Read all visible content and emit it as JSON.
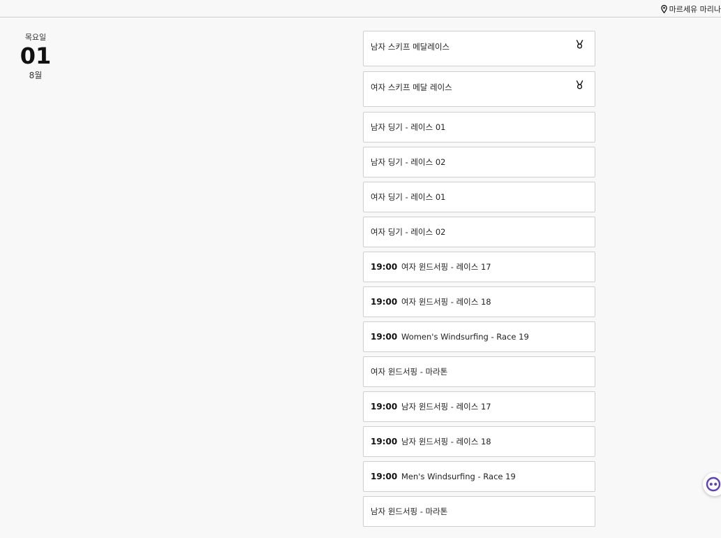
{
  "header": {
    "location": "마르세유 마리나"
  },
  "date": {
    "weekday": "목요일",
    "day": "01",
    "month": "8월"
  },
  "events": [
    {
      "time": "",
      "title": "남자 스키프 메달레이스",
      "medal": true
    },
    {
      "time": "",
      "title": "여자 스키프 메달 레이스",
      "medal": true
    },
    {
      "time": "",
      "title": "남자 딩기 - 레이스 01",
      "medal": false
    },
    {
      "time": "",
      "title": "남자 딩기 - 레이스 02",
      "medal": false
    },
    {
      "time": "",
      "title": "여자 딩기 - 레이스 01",
      "medal": false
    },
    {
      "time": "",
      "title": "여자 딩기 - 레이스 02",
      "medal": false
    },
    {
      "time": "19:00",
      "title": "여자 윈드서핑 - 레이스 17",
      "medal": false
    },
    {
      "time": "19:00",
      "title": "여자 윈드서핑 - 레이스 18",
      "medal": false
    },
    {
      "time": "19:00",
      "title": "Women's Windsurfing - Race 19",
      "medal": false
    },
    {
      "time": "",
      "title": "여자 윈드서핑 - 마라톤",
      "medal": false
    },
    {
      "time": "19:00",
      "title": "남자 윈드서핑 - 레이스 17",
      "medal": false
    },
    {
      "time": "19:00",
      "title": "남자 윈드서핑 - 레이스 18",
      "medal": false
    },
    {
      "time": "19:00",
      "title": "Men's Windsurfing - Race 19",
      "medal": false
    },
    {
      "time": "",
      "title": "남자 윈드서핑 - 마라톤",
      "medal": false
    }
  ],
  "icons": {
    "location": "map-pin-icon",
    "medal": "medal-icon",
    "chatbot": "chatbot-icon"
  },
  "colors": {
    "chatbot_accent": "#5b3fd1"
  }
}
